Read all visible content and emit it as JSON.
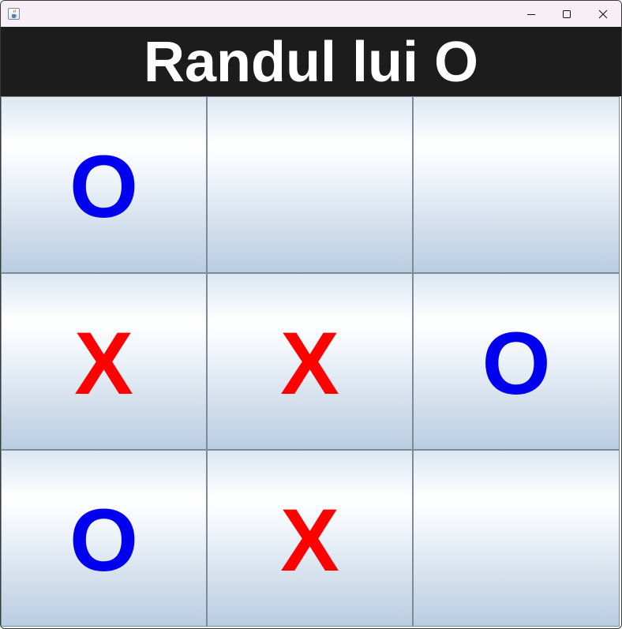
{
  "titlebar": {
    "icon": "java-cup-icon",
    "controls": {
      "minimize": "minimize-icon",
      "maximize": "maximize-icon",
      "close": "close-icon"
    }
  },
  "header": {
    "text": "Randul lui O"
  },
  "colors": {
    "X": "#ff0000",
    "O": "#0000ee",
    "header_bg": "#1c1c1c",
    "header_text": "#ffffff"
  },
  "board": {
    "cells": [
      "O",
      "",
      "",
      "X",
      "X",
      "O",
      "O",
      "X",
      ""
    ]
  }
}
